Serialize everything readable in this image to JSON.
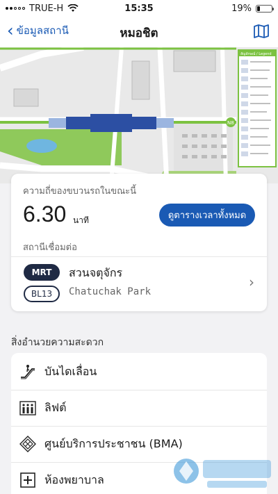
{
  "status_bar": {
    "carrier": "TRUE-H",
    "time": "15:35",
    "battery": "19%",
    "battery_level": 0.19
  },
  "nav": {
    "back_label": "ข้อมูลสถานี",
    "title": "หมอชิต",
    "map_icon": "map-icon"
  },
  "map": {
    "legend_title": "สัญลักษณ์ / Legend",
    "station_code": "N8"
  },
  "frequency": {
    "label": "ความถี่ของขบวนรถในขณะนี้",
    "value": "6.30",
    "unit": "นาที",
    "timetable_button": "ดูตารางเวลาทั้งหมด"
  },
  "connections": {
    "label": "สถานีเชื่อมต่อ",
    "items": [
      {
        "line": "MRT",
        "code": "BL13",
        "name_th": "สวนจตุจักร",
        "name_en": "Chatuchak Park"
      }
    ]
  },
  "facilities": {
    "heading": "สิ่งอำนวยความสะดวก",
    "items": [
      {
        "label": "บันไดเลื่อน",
        "icon": "escalator-icon"
      },
      {
        "label": "ลิฟต์",
        "icon": "elevator-icon"
      },
      {
        "label": "ศูนย์บริการประชาชน (BMA)",
        "icon": "service-center-icon"
      },
      {
        "label": "ห้องพยาบาล",
        "icon": "first-aid-icon"
      }
    ]
  },
  "colors": {
    "accent": "#1a5ab4",
    "mrt_badge": "#1f2a44",
    "map_green": "#7cc241"
  }
}
